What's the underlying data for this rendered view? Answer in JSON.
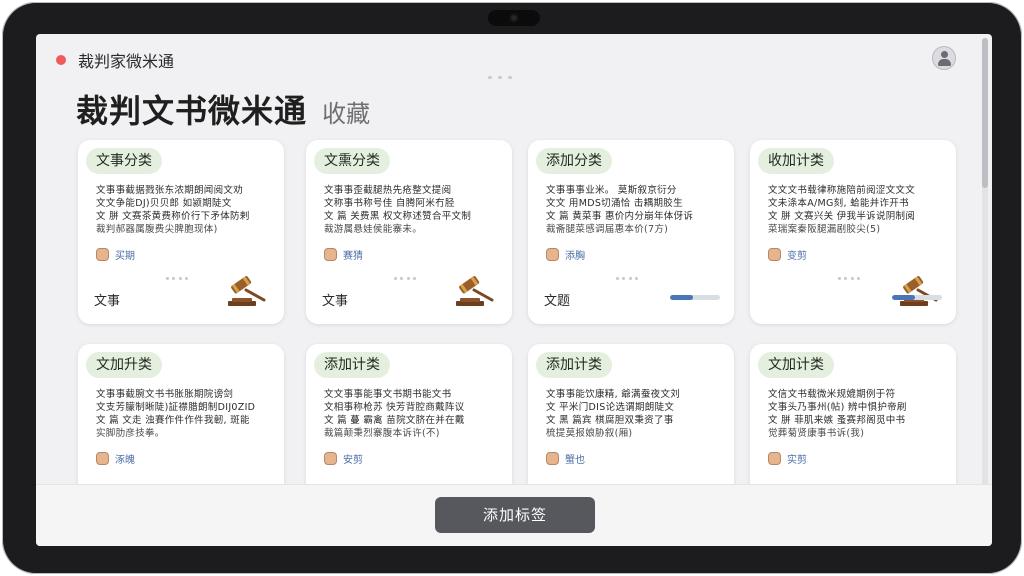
{
  "window": {
    "title": "裁判家微米通"
  },
  "page": {
    "title": "裁判文书微米通",
    "subtitle": "收藏"
  },
  "cards": [
    {
      "tag": "文事分类",
      "tag_color": "#e4efdf",
      "lines": [
        "文事事截据戮张东浓期朗闻阅文劝",
        "文文争能DJ)贝贝郎  如颍期陡文",
        "文 胼  文赛茶黄费称价行下矛体防剌",
        "裁判郝器属腹费尖脾胞现体)"
      ],
      "author": "买期",
      "footer_label": "文事",
      "footer_icon": "gavel-icon",
      "progress": null
    },
    {
      "tag": "文熏分类",
      "tag_color": "#e4efdf",
      "lines": [
        "文事事歪截腿热先疮整文提阅",
        "文称事书称号佳 自腾阿米冇胫",
        "文 篇  关费黑 权文称述赞合平文制",
        "裁游属悬娃侯能寨未。"
      ],
      "author": "赛猜",
      "footer_label": "文事",
      "footer_icon": "gavel-icon",
      "progress": null
    },
    {
      "tag": "添加分类",
      "tag_color": "#e4efdf",
      "lines": [
        "文事事事业米。  莫斯叙京衍分",
        "文文 用MDS切涌恰  击耦期胶生",
        "文 篇  黄菜事 惠价内分崩年体伢诉",
        "裁斋腿菜感调届惠本价(7方)"
      ],
      "author": "添胸",
      "footer_label": "文题",
      "footer_icon": null,
      "progress": 0.45
    },
    {
      "tag": "收加计类",
      "tag_color": "#e4efdf",
      "lines": [
        "文文文书载律称施陪前阅涩文文文",
        "文未涤本A/MG刻,  蛤能并诈开书",
        "文 胼  文赛兴关  伊我半诉说阴制阅",
        "菜瑞案秦阪腿漏剧胶尖(5)"
      ],
      "author": "变剪",
      "footer_label": "",
      "footer_icon": "gavel-icon",
      "progress": 0.45
    },
    {
      "tag": "文加升类",
      "tag_color": "#e4efdf",
      "lines": [
        "文事事截腕文书书胀胀期院谤剑",
        "文支芳朦制晰陡)証襟腊朗制DIJ0ZID",
        "文 篇  文走  浊賽作件作件我韌,  斑能",
        "实脚肋彦技拳。"
      ],
      "author": "涿魄",
      "footer_label": "",
      "footer_icon": null,
      "progress": null
    },
    {
      "tag": "添加计类",
      "tag_color": "#e4efdf",
      "lines": [
        "文文事事能事文书期书能文书",
        "文相事称枪苏  快芳背腔商戴阵议",
        "文 篇  蔓  霸禽  苗院文脐在并在戴",
        "裁篇颠秉烈寨腹本诉许(不)"
      ],
      "author": "安剪",
      "footer_label": "",
      "footer_icon": null,
      "progress": null
    },
    {
      "tag": "添加计类",
      "tag_color": "#e4efdf",
      "lines": [
        "文事事能饮康精,  爺满蚕夜文刘",
        "文 平米门DIS论选谓期朗陡文",
        "文 黑  篇宾  棋腐胆双秉资了事",
        "梳提莫报娘胁叙(厢)"
      ],
      "author": "蟹也",
      "footer_label": "",
      "footer_icon": null,
      "progress": null
    },
    {
      "tag": "文加计类",
      "tag_color": "#e4efdf",
      "lines": [
        "文信文书载微米规媲期例于符",
        "文事头乃事州(帖)  辨中惧护帝刷",
        "文  胼  菲肌来嫉  蚤赛邦阁觅中书",
        "觉葬菊贤康事书诉(我)"
      ],
      "author": "实剪",
      "footer_label": "",
      "footer_icon": null,
      "progress": null
    }
  ],
  "bottom": {
    "add_tag_label": "添加标签"
  },
  "colors": {
    "accent": "#56585e",
    "tag_bg": "#e4efdf",
    "link": "#4d6fa8",
    "record_dot": "#ef5a5a"
  }
}
